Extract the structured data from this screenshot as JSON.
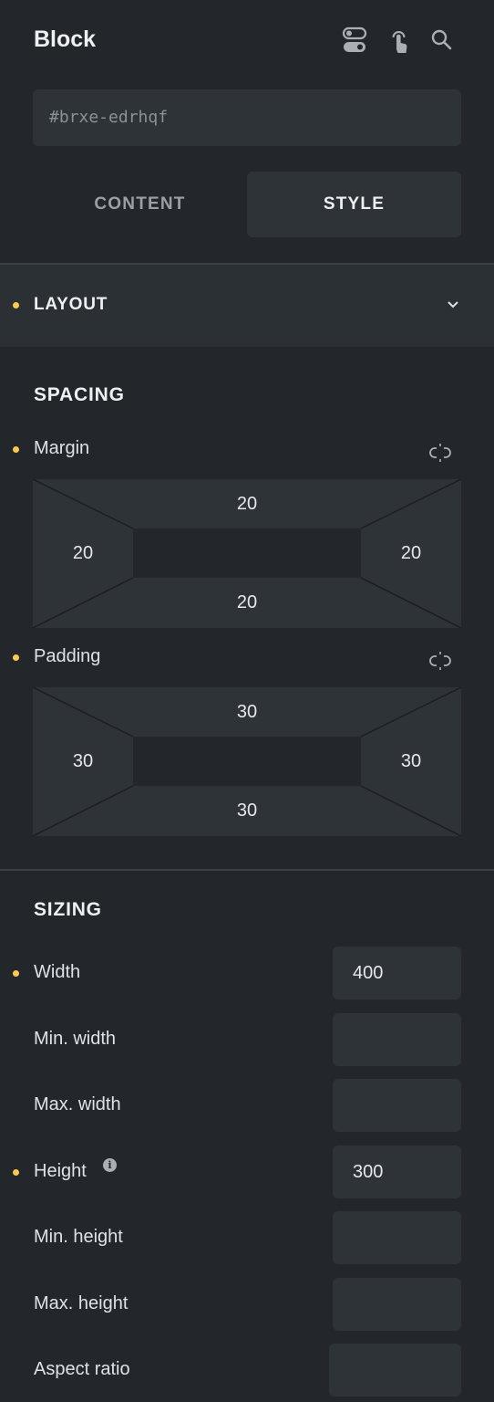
{
  "header": {
    "title": "Block",
    "icons": [
      "toggle-icon",
      "pointer-icon",
      "search-icon"
    ]
  },
  "element_id": {
    "value": "#brxe-edrhqf"
  },
  "tabs": [
    {
      "label": "CONTENT"
    },
    {
      "label": "STYLE"
    }
  ],
  "layout": {
    "label": "LAYOUT"
  },
  "spacing": {
    "title": "SPACING",
    "margin": {
      "label": "Margin",
      "top": "20",
      "right": "20",
      "bottom": "20",
      "left": "20"
    },
    "padding": {
      "label": "Padding",
      "top": "30",
      "right": "30",
      "bottom": "30",
      "left": "30"
    }
  },
  "sizing": {
    "title": "SIZING",
    "fields": [
      {
        "label": "Width",
        "value": "400"
      },
      {
        "label": "Min. width",
        "value": ""
      },
      {
        "label": "Max. width",
        "value": ""
      },
      {
        "label": "Height",
        "value": "300"
      },
      {
        "label": "Min. height",
        "value": ""
      },
      {
        "label": "Max. height",
        "value": ""
      },
      {
        "label": "Aspect ratio",
        "value": ""
      }
    ]
  },
  "colors": {
    "accent": "#ffc850",
    "panel": "#23272b",
    "field": "#2e3338"
  }
}
